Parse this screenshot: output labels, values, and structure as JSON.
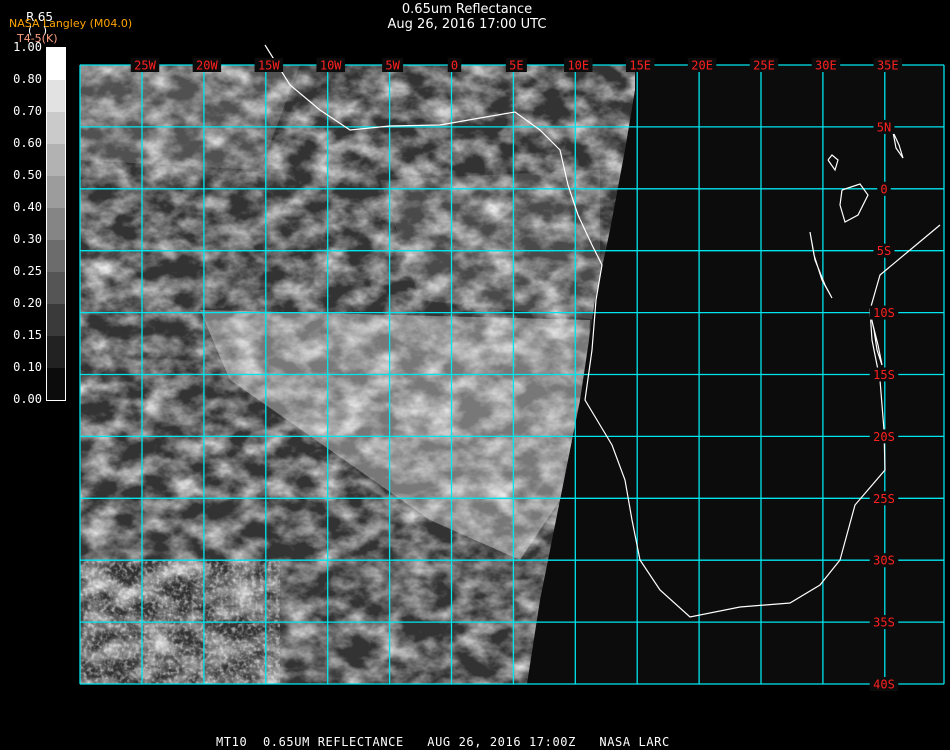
{
  "header": {
    "title": "0.65um Reflectance",
    "subtitle": "Aug 26, 2016 17:00 UTC"
  },
  "legend": {
    "product": "R.65",
    "source": "NASA Langley (M04.0)",
    "units": "(   )",
    "secondary": "T4-5(K)",
    "source_color": "#ffa500",
    "secondary_color": "#ff9f80"
  },
  "colorbar": {
    "labels": [
      "0.00",
      "0.10",
      "0.15",
      "0.20",
      "0.25",
      "0.30",
      "0.40",
      "0.50",
      "0.60",
      "0.70",
      "0.80",
      "1.00"
    ],
    "colors": [
      "#0c0c0c",
      "#222222",
      "#3a3a3a",
      "#555555",
      "#6c6c6c",
      "#858585",
      "#9c9c9c",
      "#b2b2b2",
      "#cacaca",
      "#e2e2e2",
      "#ffffff"
    ]
  },
  "map": {
    "grid_color": "#00e5ee",
    "label_color": "#ff2020",
    "coast_color": "#ffffff",
    "lon_labels": [
      "25W",
      "20W",
      "15W",
      "10W",
      "5W",
      "0",
      "5E",
      "10E",
      "15E",
      "20E",
      "25E",
      "30E",
      "35E"
    ],
    "lat_labels": [
      "5N",
      "0",
      "5S",
      "10S",
      "15S",
      "20S",
      "25S",
      "30S",
      "35S",
      "40S"
    ]
  },
  "caption": "MT10  0.65UM REFLECTANCE   AUG 26, 2016 17:00Z   NASA LARC"
}
